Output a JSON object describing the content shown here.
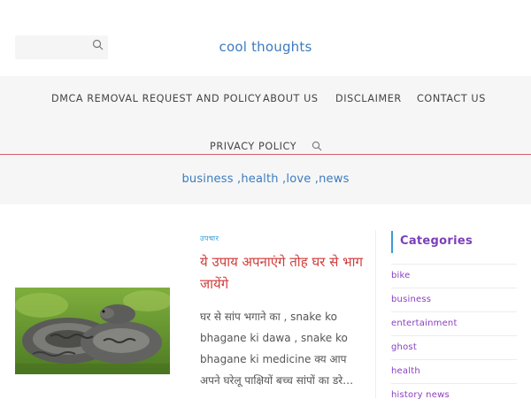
{
  "header": {
    "site_title": "cool thoughts",
    "search": {
      "placeholder": "",
      "value": "",
      "icon": "search-icon"
    }
  },
  "nav": {
    "items": [
      {
        "label": "DMCA REMOVAL REQUEST AND POLICY"
      },
      {
        "label": "ABOUT US"
      },
      {
        "label": "DISCLAIMER"
      },
      {
        "label": "CONTACT US"
      },
      {
        "label": "PRIVACY POLICY"
      }
    ],
    "search_icon": "search-icon"
  },
  "tagline": "business ,health ,love ,news",
  "post": {
    "category": "उपचार",
    "title": "ये उपाय अपनाएंगे तोह घर से भाग जायेंगे",
    "excerpt": "घर से सांप भगाने का , snake ko bhagane ki dawa , snake ko bhagane ki medicine क्य आप अपने घरेलू पाक्षियों बच्च सांपों का डरे…",
    "image": "snake-photo"
  },
  "sidebar": {
    "heading": "Categories",
    "categories": [
      "bike",
      "business",
      "entertainment",
      "ghost",
      "health",
      "history news"
    ]
  },
  "colors": {
    "accent_blue": "#3b7bbf",
    "title_red": "#d23b3b",
    "category_purple": "#7b3fb7",
    "nav_border": "#d45b6b"
  }
}
